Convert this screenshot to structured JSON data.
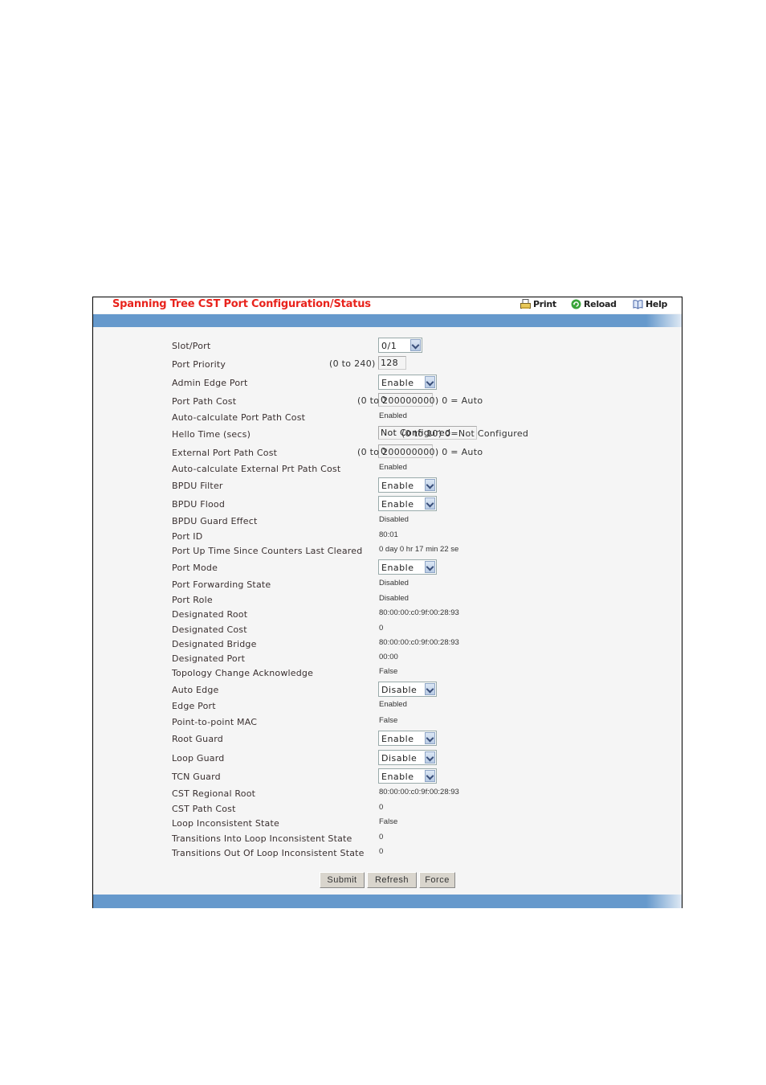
{
  "header": {
    "title": "Spanning Tree CST Port Configuration/Status",
    "print_label": "Print",
    "reload_label": "Reload",
    "help_label": "Help"
  },
  "colors": {
    "title": "#e8231c",
    "bar": "#6699cc",
    "panel_bg": "#f5f5f5"
  },
  "fields": [
    {
      "label": "Slot/Port",
      "type": "select",
      "value": "0/1"
    },
    {
      "label": "Port Priority",
      "type": "input",
      "value": "128",
      "hint": "(0 to 240)"
    },
    {
      "label": "Admin Edge Port",
      "type": "select",
      "value": "Enable"
    },
    {
      "label": "Port Path Cost",
      "type": "input",
      "value": "0",
      "hint": "(0 to 200000000) 0 = Auto"
    },
    {
      "label": "Auto-calculate Port Path Cost",
      "type": "text",
      "value": "Enabled"
    },
    {
      "label": "Hello Time (secs)",
      "type": "input",
      "value": "Not Configured",
      "hint": "(0 to 10) 0=Not Configured"
    },
    {
      "label": "External Port Path Cost",
      "type": "input",
      "value": "0",
      "hint": "(0 to 200000000) 0 = Auto"
    },
    {
      "label": "Auto-calculate External Prt Path Cost",
      "type": "text",
      "value": "Enabled"
    },
    {
      "label": "BPDU Filter",
      "type": "select",
      "value": "Enable"
    },
    {
      "label": "BPDU Flood",
      "type": "select",
      "value": "Enable"
    },
    {
      "label": "BPDU Guard Effect",
      "type": "text",
      "value": "Disabled"
    },
    {
      "label": "Port ID",
      "type": "text",
      "value": "80:01"
    },
    {
      "label": "Port Up Time Since Counters Last Cleared",
      "type": "text",
      "value": "0 day 0 hr 17 min 22 se"
    },
    {
      "label": "Port Mode",
      "type": "select",
      "value": "Enable"
    },
    {
      "label": "Port Forwarding State",
      "type": "text",
      "value": "Disabled"
    },
    {
      "label": "Port Role",
      "type": "text",
      "value": "Disabled"
    },
    {
      "label": "Designated Root",
      "type": "text",
      "value": "80:00:00:c0:9f:00:28:93"
    },
    {
      "label": "Designated Cost",
      "type": "text",
      "value": "0"
    },
    {
      "label": "Designated Bridge",
      "type": "text",
      "value": "80:00:00:c0:9f:00:28:93"
    },
    {
      "label": "Designated Port",
      "type": "text",
      "value": "00:00"
    },
    {
      "label": "Topology Change Acknowledge",
      "type": "text",
      "value": "False"
    },
    {
      "label": "Auto Edge",
      "type": "select",
      "value": "Disable"
    },
    {
      "label": "Edge Port",
      "type": "text",
      "value": "Enabled"
    },
    {
      "label": "Point-to-point MAC",
      "type": "text",
      "value": "False"
    },
    {
      "label": "Root Guard",
      "type": "select",
      "value": "Enable"
    },
    {
      "label": "Loop Guard",
      "type": "select",
      "value": "Disable"
    },
    {
      "label": "TCN Guard",
      "type": "select",
      "value": "Enable"
    },
    {
      "label": "CST Regional Root",
      "type": "text",
      "value": "80:00:00:c0:9f:00:28:93"
    },
    {
      "label": "CST Path Cost",
      "type": "text",
      "value": "0"
    },
    {
      "label": "Loop Inconsistent State",
      "type": "text",
      "value": "False"
    },
    {
      "label": "Transitions Into Loop Inconsistent State",
      "type": "text",
      "value": "0"
    },
    {
      "label": "Transitions Out Of Loop Inconsistent State",
      "type": "text",
      "value": "0"
    }
  ],
  "buttons": {
    "submit": "Submit",
    "refresh": "Refresh",
    "force": "Force"
  }
}
